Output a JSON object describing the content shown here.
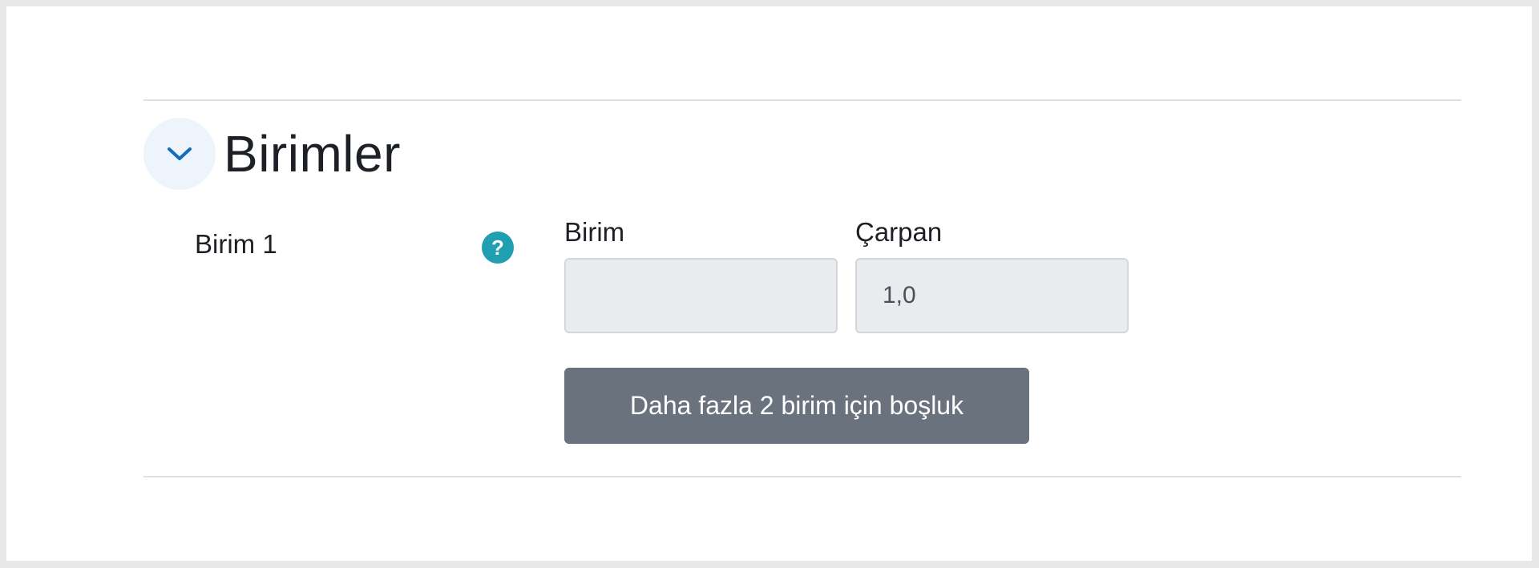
{
  "section": {
    "title": "Birimler",
    "toggle_icon": "chevron-down-icon",
    "toggle_color": "#0f6cbf"
  },
  "unit_row": {
    "label": "Birim 1",
    "help_icon": "question-circle-icon",
    "help_symbol": "?",
    "help_color": "#1f9fb0",
    "unit_field": {
      "label": "Birim",
      "value": ""
    },
    "multiplier_field": {
      "label": "Çarpan",
      "value": "1,0"
    }
  },
  "add_more_button": {
    "label": "Daha fazla 2 birim için boşluk",
    "color": "#6a737d"
  }
}
